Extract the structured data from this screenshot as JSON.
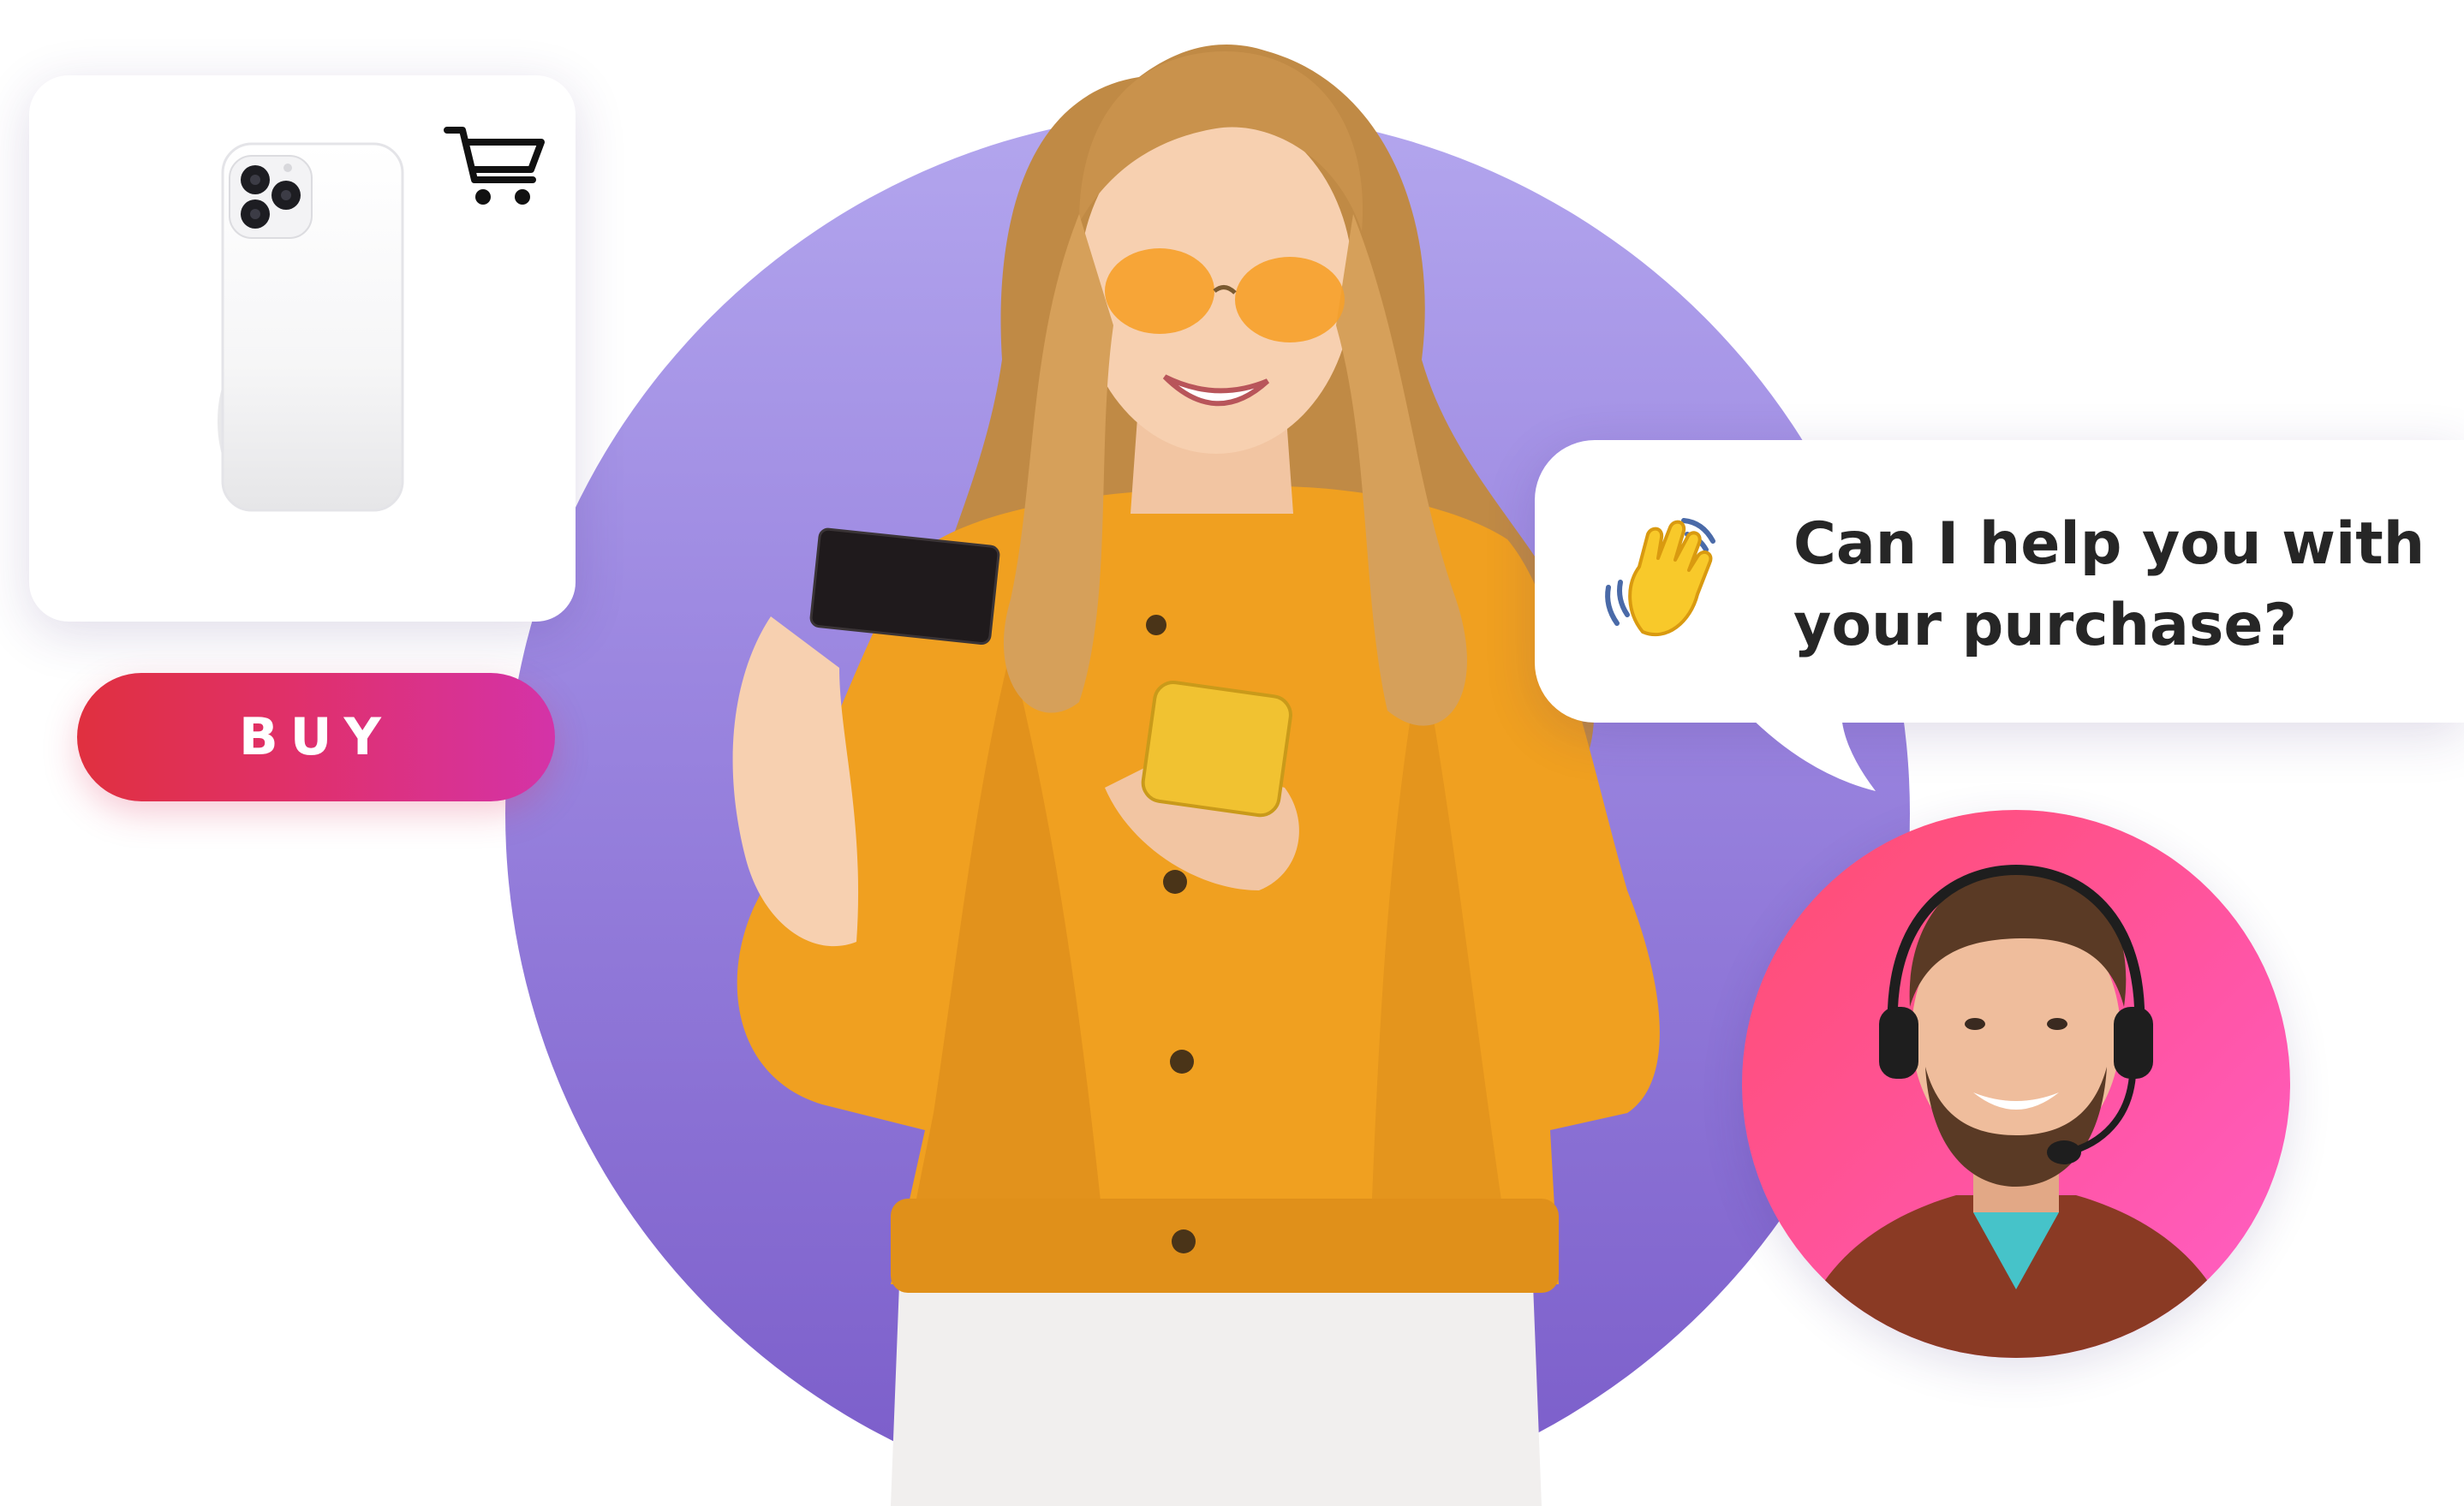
{
  "product_card": {
    "product_image": "white-smartphone",
    "cart_icon": "shopping-cart-icon"
  },
  "buy_button": {
    "label": "BUY"
  },
  "chat_bubble": {
    "icon": "waving-hand-icon",
    "message_lines": [
      "Can I help you with",
      "your purchase?"
    ]
  },
  "agent": {
    "avatar": "support-agent-with-headset"
  },
  "colors": {
    "backdrop_purple": "#9b86e0",
    "buy_gradient_start": "#e0303f",
    "buy_gradient_end": "#d433a8",
    "agent_bg_start": "#ff4d6d",
    "agent_bg_end": "#ff60c8",
    "jacket_orange": "#f0a020",
    "text_dark": "#262626"
  }
}
